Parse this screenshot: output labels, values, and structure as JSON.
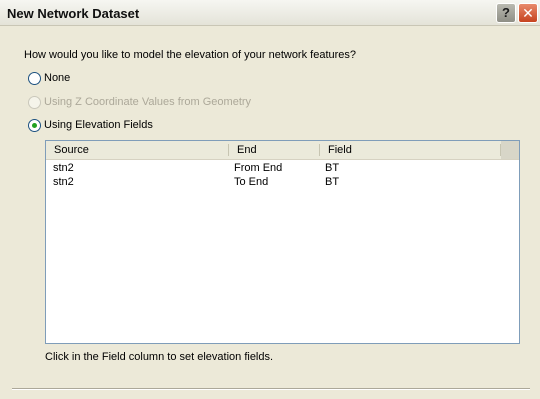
{
  "window": {
    "title": "New Network Dataset",
    "help_label": "?",
    "close_label": "✕"
  },
  "question": "How would you like to model the elevation of your network features?",
  "options": [
    {
      "label": "None",
      "selected": false,
      "enabled": true
    },
    {
      "label": "Using Z Coordinate Values from Geometry",
      "selected": false,
      "enabled": false
    },
    {
      "label": "Using Elevation Fields",
      "selected": true,
      "enabled": true
    }
  ],
  "table": {
    "columns": [
      "Source",
      "End",
      "Field"
    ],
    "rows": [
      [
        "stn2",
        "From End",
        "BT"
      ],
      [
        "stn2",
        "To End",
        "BT"
      ]
    ]
  },
  "hint": "Click in the Field column to set elevation fields.",
  "colors": {
    "face": "#ece9d8",
    "list_border": "#7f9db9",
    "radio_dot": "#21a121",
    "disabled_text": "#aca899"
  }
}
